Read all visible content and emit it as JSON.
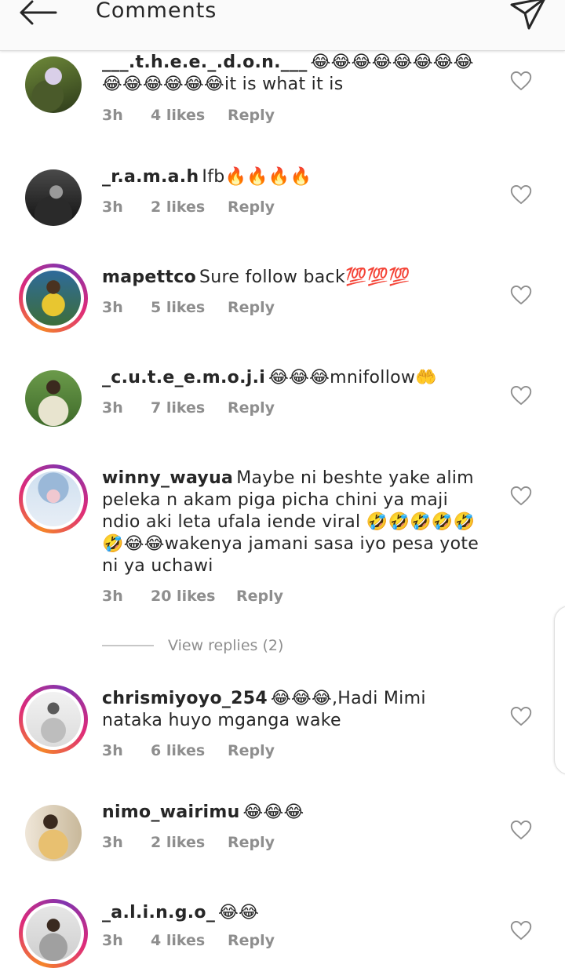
{
  "header": {
    "title": "Comments",
    "back_icon": "arrow-left-icon",
    "send_icon": "paper-plane-icon"
  },
  "view_replies": "View replies (2)",
  "comments": [
    {
      "username": "___.t.h.e.e._.d.o.n.___",
      "text": "😂😂😂😂😂😂😂😂😂😂😂😂😂😂it is what it is",
      "time": "3h",
      "likes": "4 likes",
      "reply": "Reply",
      "story_ring": false,
      "avatar_colors": [
        "#6f8a3a",
        "#2d3a1a",
        "#d9cfe8"
      ]
    },
    {
      "username": "_r.a.m.a.h",
      "text": "Ifb🔥🔥🔥🔥",
      "time": "3h",
      "likes": "2 likes",
      "reply": "Reply",
      "story_ring": false,
      "avatar_colors": [
        "#4a4a4a",
        "#111111",
        "#9a9a9a"
      ]
    },
    {
      "username": "mapettco",
      "text": "Sure follow back💯💯💯",
      "time": "3h",
      "likes": "5 likes",
      "reply": "Reply",
      "story_ring": true,
      "avatar_colors": [
        "#e8c630",
        "#4a3220",
        "#2e6a9a"
      ]
    },
    {
      "username": "_c.u.t.e_e.m.o.j.i",
      "text": "😂😂😂mnifollow🤲",
      "time": "3h",
      "likes": "7 likes",
      "reply": "Reply",
      "story_ring": false,
      "avatar_colors": [
        "#6b9a4a",
        "#e8e4cf",
        "#3b2a1e"
      ]
    },
    {
      "username": "winny_wayua",
      "text": "Maybe ni beshte yake alim peleka n akam piga picha chini ya maji ndio aki leta ufala iende viral 🤣🤣🤣🤣🤣🤣😂😂wakenya jamani sasa iyo pesa yote ni ya uchawi",
      "time": "3h",
      "likes": "20 likes",
      "reply": "Reply",
      "story_ring": true,
      "avatar_colors": [
        "#cfe0f0",
        "#9ab8d8",
        "#f0c8d0"
      ]
    },
    {
      "username": "chrismiyoyo_254",
      "text": "😂😂😂,Hadi Mimi nataka huyo mganga wake",
      "time": "3h",
      "likes": "6 likes",
      "reply": "Reply",
      "story_ring": true,
      "avatar_colors": [
        "#f2f2f2",
        "#bdbdbd",
        "#5a5a5a"
      ]
    },
    {
      "username": "nimo_wairimu",
      "text": "😂😂😂",
      "time": "3h",
      "likes": "2 likes",
      "reply": "Reply",
      "story_ring": false,
      "avatar_colors": [
        "#e8c070",
        "#3a2a1e",
        "#efe6d8"
      ]
    },
    {
      "username": "_a.l.i.n.g.o_",
      "text": "😂😂",
      "time": "3h",
      "likes": "4 likes",
      "reply": "Reply",
      "story_ring": true,
      "avatar_colors": [
        "#e6e6e6",
        "#3a2a20",
        "#a0a0a0"
      ]
    }
  ]
}
